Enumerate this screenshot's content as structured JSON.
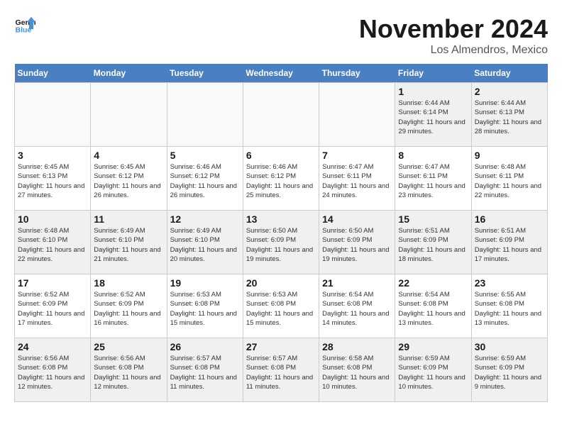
{
  "logo": {
    "line1": "General",
    "line2": "Blue"
  },
  "title": "November 2024",
  "location": "Los Almendros, Mexico",
  "days_header": [
    "Sunday",
    "Monday",
    "Tuesday",
    "Wednesday",
    "Thursday",
    "Friday",
    "Saturday"
  ],
  "weeks": [
    [
      {
        "day": "",
        "info": "",
        "empty": true
      },
      {
        "day": "",
        "info": "",
        "empty": true
      },
      {
        "day": "",
        "info": "",
        "empty": true
      },
      {
        "day": "",
        "info": "",
        "empty": true
      },
      {
        "day": "",
        "info": "",
        "empty": true
      },
      {
        "day": "1",
        "info": "Sunrise: 6:44 AM\nSunset: 6:14 PM\nDaylight: 11 hours and 29 minutes."
      },
      {
        "day": "2",
        "info": "Sunrise: 6:44 AM\nSunset: 6:13 PM\nDaylight: 11 hours and 28 minutes."
      }
    ],
    [
      {
        "day": "3",
        "info": "Sunrise: 6:45 AM\nSunset: 6:13 PM\nDaylight: 11 hours and 27 minutes."
      },
      {
        "day": "4",
        "info": "Sunrise: 6:45 AM\nSunset: 6:12 PM\nDaylight: 11 hours and 26 minutes."
      },
      {
        "day": "5",
        "info": "Sunrise: 6:46 AM\nSunset: 6:12 PM\nDaylight: 11 hours and 26 minutes."
      },
      {
        "day": "6",
        "info": "Sunrise: 6:46 AM\nSunset: 6:12 PM\nDaylight: 11 hours and 25 minutes."
      },
      {
        "day": "7",
        "info": "Sunrise: 6:47 AM\nSunset: 6:11 PM\nDaylight: 11 hours and 24 minutes."
      },
      {
        "day": "8",
        "info": "Sunrise: 6:47 AM\nSunset: 6:11 PM\nDaylight: 11 hours and 23 minutes."
      },
      {
        "day": "9",
        "info": "Sunrise: 6:48 AM\nSunset: 6:11 PM\nDaylight: 11 hours and 22 minutes."
      }
    ],
    [
      {
        "day": "10",
        "info": "Sunrise: 6:48 AM\nSunset: 6:10 PM\nDaylight: 11 hours and 22 minutes."
      },
      {
        "day": "11",
        "info": "Sunrise: 6:49 AM\nSunset: 6:10 PM\nDaylight: 11 hours and 21 minutes."
      },
      {
        "day": "12",
        "info": "Sunrise: 6:49 AM\nSunset: 6:10 PM\nDaylight: 11 hours and 20 minutes."
      },
      {
        "day": "13",
        "info": "Sunrise: 6:50 AM\nSunset: 6:09 PM\nDaylight: 11 hours and 19 minutes."
      },
      {
        "day": "14",
        "info": "Sunrise: 6:50 AM\nSunset: 6:09 PM\nDaylight: 11 hours and 19 minutes."
      },
      {
        "day": "15",
        "info": "Sunrise: 6:51 AM\nSunset: 6:09 PM\nDaylight: 11 hours and 18 minutes."
      },
      {
        "day": "16",
        "info": "Sunrise: 6:51 AM\nSunset: 6:09 PM\nDaylight: 11 hours and 17 minutes."
      }
    ],
    [
      {
        "day": "17",
        "info": "Sunrise: 6:52 AM\nSunset: 6:09 PM\nDaylight: 11 hours and 17 minutes."
      },
      {
        "day": "18",
        "info": "Sunrise: 6:52 AM\nSunset: 6:09 PM\nDaylight: 11 hours and 16 minutes."
      },
      {
        "day": "19",
        "info": "Sunrise: 6:53 AM\nSunset: 6:08 PM\nDaylight: 11 hours and 15 minutes."
      },
      {
        "day": "20",
        "info": "Sunrise: 6:53 AM\nSunset: 6:08 PM\nDaylight: 11 hours and 15 minutes."
      },
      {
        "day": "21",
        "info": "Sunrise: 6:54 AM\nSunset: 6:08 PM\nDaylight: 11 hours and 14 minutes."
      },
      {
        "day": "22",
        "info": "Sunrise: 6:54 AM\nSunset: 6:08 PM\nDaylight: 11 hours and 13 minutes."
      },
      {
        "day": "23",
        "info": "Sunrise: 6:55 AM\nSunset: 6:08 PM\nDaylight: 11 hours and 13 minutes."
      }
    ],
    [
      {
        "day": "24",
        "info": "Sunrise: 6:56 AM\nSunset: 6:08 PM\nDaylight: 11 hours and 12 minutes."
      },
      {
        "day": "25",
        "info": "Sunrise: 6:56 AM\nSunset: 6:08 PM\nDaylight: 11 hours and 12 minutes."
      },
      {
        "day": "26",
        "info": "Sunrise: 6:57 AM\nSunset: 6:08 PM\nDaylight: 11 hours and 11 minutes."
      },
      {
        "day": "27",
        "info": "Sunrise: 6:57 AM\nSunset: 6:08 PM\nDaylight: 11 hours and 11 minutes."
      },
      {
        "day": "28",
        "info": "Sunrise: 6:58 AM\nSunset: 6:08 PM\nDaylight: 11 hours and 10 minutes."
      },
      {
        "day": "29",
        "info": "Sunrise: 6:59 AM\nSunset: 6:09 PM\nDaylight: 11 hours and 10 minutes."
      },
      {
        "day": "30",
        "info": "Sunrise: 6:59 AM\nSunset: 6:09 PM\nDaylight: 11 hours and 9 minutes."
      }
    ]
  ]
}
